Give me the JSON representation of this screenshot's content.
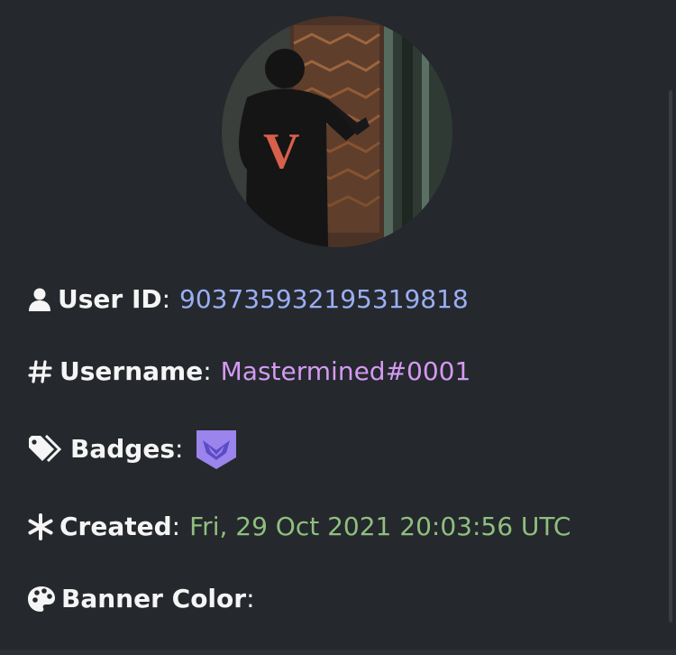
{
  "profile": {
    "avatar_alt": "avatar",
    "user_id_label": "User ID",
    "user_id_value": "903735932195319818",
    "username_label": "Username",
    "username_value": "Mastermined#0001",
    "badges_label": "Badges",
    "created_label": "Created",
    "created_value": "Fri, 29 Oct 2021 20:03:56 UTC",
    "banner_label": "Banner Color",
    "separator": ":",
    "badge_icon": "hypesquad-badge-icon"
  },
  "colors": {
    "background": "#25282d",
    "label": "#f5f5f5",
    "user_id": "#9aaef4",
    "username": "#d39af1",
    "created": "#8fbf7f",
    "badge": "#9b84ec"
  }
}
